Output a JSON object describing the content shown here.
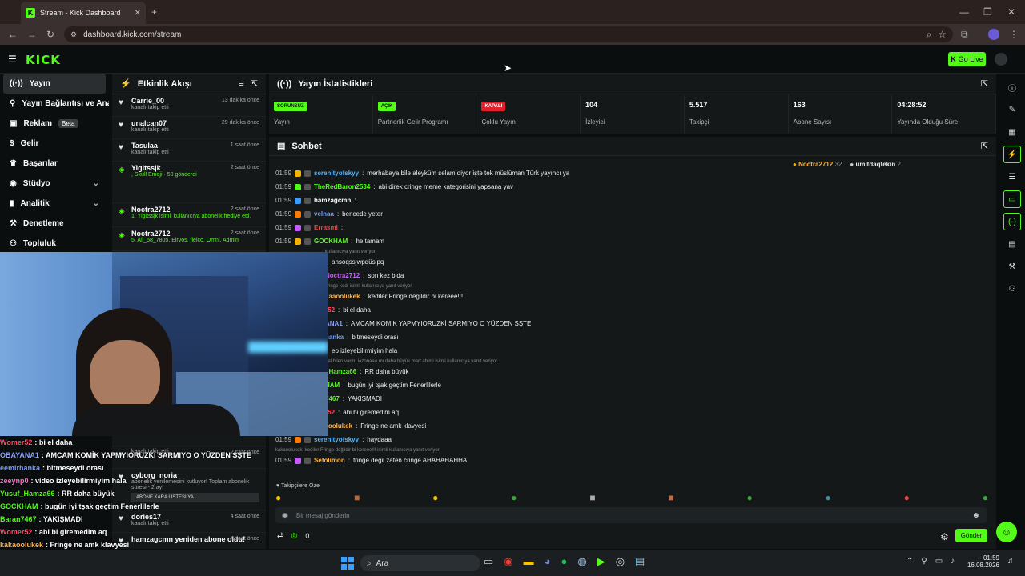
{
  "browser": {
    "tab_title": "Stream - Kick Dashboard",
    "url": "dashboard.kick.com/stream"
  },
  "app": {
    "logo": "KICK",
    "go_live": "Go Live"
  },
  "sidebar": {
    "items": [
      {
        "label": "Yayın"
      },
      {
        "label": "Yayın Bağlantısı ve Anahtar"
      },
      {
        "label": "Reklam",
        "badge": "Beta"
      },
      {
        "label": "Gelir"
      },
      {
        "label": "Başarılar"
      },
      {
        "label": "Stüdyo"
      },
      {
        "label": "Analitik"
      },
      {
        "label": "Denetleme"
      },
      {
        "label": "Topluluk"
      }
    ]
  },
  "activity": {
    "title": "Etkinlik Akışı",
    "items": [
      {
        "name": "Carrie_00",
        "desc": "kanalı takip etti",
        "time": "13 dakika önce"
      },
      {
        "name": "unalcan07",
        "desc": "kanalı takip etti",
        "time": "29 dakika önce"
      },
      {
        "name": "Tasulaa",
        "desc": "kanalı takip etti",
        "time": "1 saat önce"
      },
      {
        "name": "Yigitssjk",
        "desc": ", Skull Emoji · 50 gönderdi",
        "time": "2 saat önce"
      },
      {
        "name": "Noctra2712",
        "desc": "1, Yigitssjk isimli kullanıcıya abonelik hediye etti.",
        "time": "2 saat önce"
      },
      {
        "name": "Noctra2712",
        "desc": "5, Ali_58_7805, Eirvos, fleico, Omni, Admin",
        "time": "2 saat önce"
      }
    ],
    "lower": [
      {
        "name": "",
        "desc": "kanalı takip etti",
        "time": ""
      },
      {
        "name": "",
        "desc": "kanalı takip etti",
        "time": "2 saat önce"
      },
      {
        "name": "cyborg_noria",
        "desc": "abonelik yenilemesini kutluyor! Toplam abonelik süresi - 2 ay!",
        "time": ""
      },
      {
        "name": "dories17",
        "desc": "kanalı takip etti",
        "time": "4 saat önce"
      },
      {
        "name": "hamzagcmn yeniden abone oldu!",
        "desc": "",
        "time": "4 saat önce"
      }
    ],
    "blacklist": "ABONE KARA LISTESI YA"
  },
  "stats": {
    "title": "Yayın İstatistikleri",
    "items": [
      {
        "value": "SORUNSUZ",
        "label": "Yayın",
        "pill": "#53fc18"
      },
      {
        "value": "AÇIK",
        "label": "Partnerlik Gelir Programı",
        "pill": "#53fc18"
      },
      {
        "value": "KAPALI",
        "label": "Çoklu Yayın",
        "pill": "#e5202e"
      },
      {
        "value": "104",
        "label": "İzleyici"
      },
      {
        "value": "5.517",
        "label": "Takipçi"
      },
      {
        "value": "163",
        "label": "Abone Sayısı"
      },
      {
        "value": "04:28:52",
        "label": "Yayında Olduğu Süre"
      }
    ]
  },
  "chat": {
    "title": "Sohbet",
    "top_gifters": [
      {
        "name": "Noctra2712",
        "count": "32"
      },
      {
        "name": "umitdaqtekin",
        "count": "2"
      }
    ],
    "messages": [
      {
        "time": "01:59",
        "user": "serenityofskyy",
        "color": "#53b6fc",
        "text": "merhabaya bile aleyküm selam diyor işte tek müslüman Türk yayıncı ya"
      },
      {
        "time": "01:59",
        "user": "TheRedBaron2534",
        "color": "#53fc18",
        "text": "abi direk cringe meme kategorisini yapsana yav"
      },
      {
        "time": "01:59",
        "user": "hamzagcmn",
        "color": "#ffffff",
        "text": ""
      },
      {
        "time": "01:59",
        "user": "velnaa",
        "color": "#6e9bff",
        "text": "bencede yeter"
      },
      {
        "time": "01:59",
        "user": "Errasmi",
        "color": "#e04848",
        "text": ""
      },
      {
        "time": "01:59",
        "user": "GOCKHAM",
        "color": "#53fc18",
        "text": "he tamam"
      },
      {
        "time": "",
        "user": "",
        "color": "#fff",
        "text": "ahsoqssjwpqüslpq",
        "reply": "kullanıcıya yanıt veriyor"
      },
      {
        "time": "",
        "user": "Noctra2712",
        "color": "#c65cff",
        "text": "son kez bida"
      },
      {
        "time": "",
        "user": "kaaoolukek",
        "color": "#ffb347",
        "text": "kediler Fringe değildir bi kereee!!!",
        "reply": "cringe kedi isimli kullanıcıya yanıt veriyor"
      },
      {
        "time": "",
        "user": "r52",
        "color": "#ff4d6a",
        "text": "bi el daha"
      },
      {
        "time": "",
        "user": "ANA1",
        "color": "#8aa0ff",
        "text": "AMCAM KOMİK YAPMYIORUZKİ SARMIYO O YÜZDEN SŞTE"
      },
      {
        "time": "",
        "user": "hanka",
        "color": "#6e9bff",
        "text": "bitmeseydi orası"
      },
      {
        "time": "",
        "user": "",
        "color": "#fff",
        "text": "eo izleyebilirmiyim hala"
      },
      {
        "time": "",
        "user": "_Hamza66",
        "color": "#53fc18",
        "text": "RR daha büyük",
        "reply": "hal bilen varmı lazonaaa mı daha büyük mert abimi isimli kullanıcıya yanıt veriyor"
      },
      {
        "time": "",
        "user": "HAM",
        "color": "#53fc18",
        "text": "bugün iyi tşak geçtim Fenerlilerle"
      },
      {
        "time": "",
        "user": "7467",
        "color": "#53fc18",
        "text": "YAKIŞMADI"
      },
      {
        "time": "",
        "user": "r52",
        "color": "#ff4d6a",
        "text": "abi bi giremedim aq"
      },
      {
        "time": "01:59",
        "user": "kakaoolukek",
        "color": "#ffb347",
        "text": "Fringe ne amk klavyesi"
      },
      {
        "time": "01:59",
        "user": "serenityofskyy",
        "color": "#53b6fc",
        "text": "haydaaa"
      },
      {
        "time": "01:59",
        "user": "Sefolimon",
        "color": "#ffb347",
        "text": "fringe değil zaten cringe AHAHAHAHHA",
        "reply": "kakaoolukek: kediler Fringe değildir bi kereee!!! isimli kullanıcıya yanıt veriyor"
      }
    ],
    "followers_only": "Takipçilere Özel",
    "input_placeholder": "Bir mesaj gönderin",
    "send": "Gönder",
    "count": "0"
  },
  "overlay": [
    {
      "user": "Womer52",
      "color": "#ff4d6a",
      "text": ": bi el daha"
    },
    {
      "user": "OBAYANA1",
      "color": "#8aa0ff",
      "text": ": AMCAM KOMİK YAPMYIORUZKİ SARMIYO O YÜZDEN SŞTE"
    },
    {
      "user": "eemirhanka",
      "color": "#6e9bff",
      "text": ": bitmeseydi orası"
    },
    {
      "user": "zeeynp0",
      "color": "#ff6ec7",
      "text": ": video izleyebilirmiyim hala"
    },
    {
      "user": "Yusuf_Hamza66",
      "color": "#53fc18",
      "text": ": RR daha büyük"
    },
    {
      "user": "GOCKHAM",
      "color": "#53fc18",
      "text": ": bugün iyi tşak geçtim Fenerlilerle"
    },
    {
      "user": "Baran7467",
      "color": "#53fc18",
      "text": ": YAKIŞMADI"
    },
    {
      "user": "Womer52",
      "color": "#ff4d6a",
      "text": ": abi bi giremedim aq"
    },
    {
      "user": "kakaoolukek",
      "color": "#ffb347",
      "text": ": Fringe ne amk klavyesi"
    },
    {
      "user": "serenityofskyy",
      "color": "#53b6fc",
      "text": ": haydaaa"
    },
    {
      "user": "Sefolimon",
      "color": "#ffb347",
      "text": ": fringe değil zaten cringe AHAHAHAHHA"
    }
  ],
  "taskbar": {
    "search": "Ara",
    "time": "01:59",
    "date": "16.08.2026"
  }
}
